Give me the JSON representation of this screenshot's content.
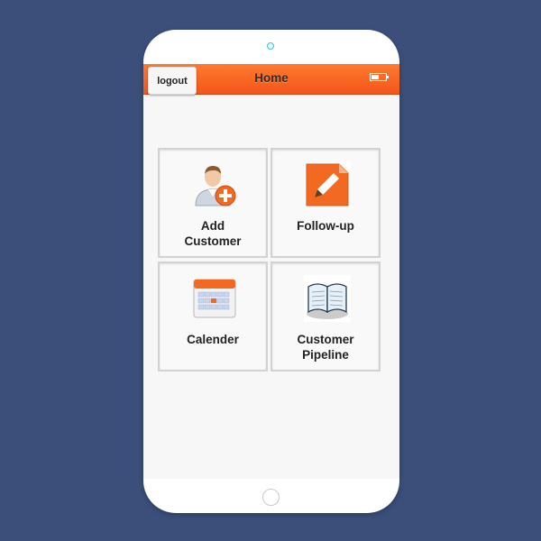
{
  "header": {
    "title": "Home",
    "logout_label": "logout",
    "battery_level": 0.55
  },
  "tiles": [
    {
      "label_line1": "Add",
      "label_line2": "Customer",
      "icon": "add-customer-icon"
    },
    {
      "label_line1": "Follow-up",
      "label_line2": "",
      "icon": "pencil-document-icon"
    },
    {
      "label_line1": "Calender",
      "label_line2": "",
      "icon": "calendar-icon"
    },
    {
      "label_line1": "Customer",
      "label_line2": "Pipeline",
      "icon": "open-book-icon"
    }
  ],
  "colors": {
    "background": "#3b4f7a",
    "appbar": "#f2561a",
    "accent": "#f26a21"
  }
}
